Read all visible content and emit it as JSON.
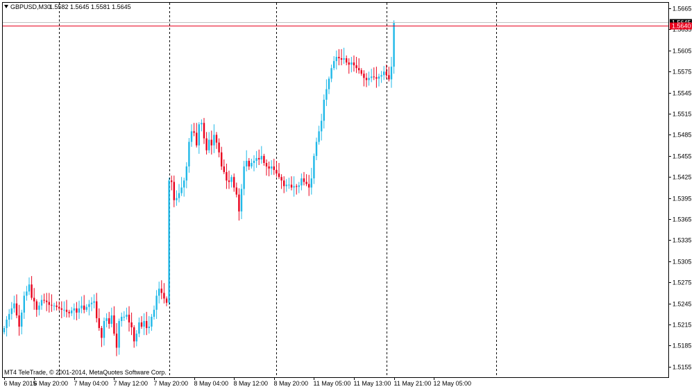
{
  "header": {
    "symbol_timeframe": "GBPUSD,M30",
    "ohlc": "1.5582 1.5645 1.5581 1.5645"
  },
  "copyright": "MT4 TeleTrade, © 2001-2014, MetaQuotes Software Corp.",
  "colors": {
    "bull": "#1fb8e8",
    "bear": "#e8001c",
    "bid_line": "#c0c0c0",
    "ask_line": "#e8001c",
    "frame": "#000000",
    "price_label_bid": "#000000",
    "price_label_ask": "#e8001c"
  },
  "chart_data": {
    "type": "candlestick",
    "title": "GBPUSD,M30",
    "ylim": [
      1.514,
      1.5673
    ],
    "y_ticks": [
      "1.5665",
      "1.5635",
      "1.5605",
      "1.5575",
      "1.5545",
      "1.5515",
      "1.5485",
      "1.5455",
      "1.5425",
      "1.5395",
      "1.5365",
      "1.5335",
      "1.5305",
      "1.5275",
      "1.5245",
      "1.5215",
      "1.5185",
      "1.5155"
    ],
    "x_ticks": [
      {
        "label": "6 May 2015",
        "index": 0
      },
      {
        "label": "6 May 20:00",
        "index": 12
      },
      {
        "label": "7 May 04:00",
        "index": 28
      },
      {
        "label": "7 May 12:00",
        "index": 44
      },
      {
        "label": "7 May 20:00",
        "index": 60
      },
      {
        "label": "8 May 04:00",
        "index": 76
      },
      {
        "label": "8 May 12:00",
        "index": 92
      },
      {
        "label": "8 May 20:00",
        "index": 108
      },
      {
        "label": "11 May 05:00",
        "index": 124
      },
      {
        "label": "11 May 13:00",
        "index": 140
      },
      {
        "label": "11 May 21:00",
        "index": 156
      },
      {
        "label": "12 May 05:00",
        "index": 172
      }
    ],
    "separators": [
      22,
      66,
      109,
      153,
      197
    ],
    "bid_price": 1.5645,
    "ask_price": 1.564,
    "bid_label": "1.5645",
    "ask_label": "1.5640",
    "closes": [
      1.521,
      1.5222,
      1.523,
      1.5238,
      1.5245,
      1.5228,
      1.5212,
      1.5232,
      1.5256,
      1.5262,
      1.5272,
      1.5253,
      1.5248,
      1.5236,
      1.5242,
      1.525,
      1.5249,
      1.5247,
      1.5243,
      1.5242,
      1.5242,
      1.524,
      1.5238,
      1.5236,
      1.5236,
      1.5233,
      1.5231,
      1.5235,
      1.5238,
      1.5232,
      1.5238,
      1.5242,
      1.5236,
      1.524,
      1.5244,
      1.5246,
      1.5248,
      1.5224,
      1.521,
      1.5196,
      1.522,
      1.5224,
      1.5216,
      1.5228,
      1.5202,
      1.5182,
      1.522,
      1.5226,
      1.5226,
      1.5229,
      1.5218,
      1.5211,
      1.5191,
      1.5202,
      1.5218,
      1.5212,
      1.522,
      1.521,
      1.5212,
      1.5226,
      1.5236,
      1.5256,
      1.5266,
      1.526,
      1.5252,
      1.5246,
      1.542,
      1.5418,
      1.5392,
      1.5395,
      1.5402,
      1.541,
      1.542,
      1.544,
      1.5475,
      1.549,
      1.5488,
      1.547,
      1.55,
      1.5502,
      1.548,
      1.5463,
      1.5478,
      1.547,
      1.5485,
      1.5474,
      1.546,
      1.544,
      1.5432,
      1.542,
      1.5418,
      1.5425,
      1.541,
      1.54,
      1.5376,
      1.5408,
      1.544,
      1.5448,
      1.544,
      1.5445,
      1.5448,
      1.5452,
      1.545,
      1.5455,
      1.5445,
      1.544,
      1.5437,
      1.544,
      1.5435,
      1.543,
      1.5425,
      1.542,
      1.5412,
      1.5414,
      1.5414,
      1.541,
      1.5412,
      1.5411,
      1.5413,
      1.5423,
      1.5418,
      1.5415,
      1.541,
      1.5423,
      1.5455,
      1.5475,
      1.549,
      1.5505,
      1.5535,
      1.555,
      1.5565,
      1.558,
      1.559,
      1.5596,
      1.5594,
      1.5592,
      1.5594,
      1.5588,
      1.5585,
      1.5588,
      1.5584,
      1.558,
      1.5577,
      1.5572,
      1.5566,
      1.5563,
      1.5566,
      1.5568,
      1.5567,
      1.5565,
      1.5568,
      1.557,
      1.5575,
      1.557,
      1.5564,
      1.5582,
      1.5645
    ]
  }
}
